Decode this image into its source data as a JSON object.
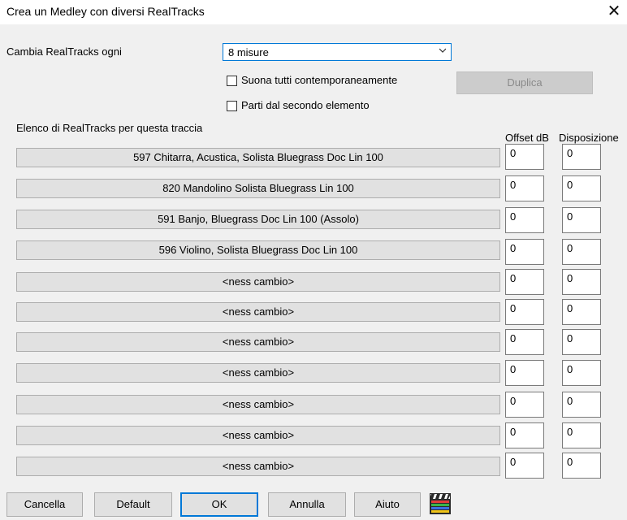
{
  "window": {
    "title": "Crea un Medley con diversi RealTracks"
  },
  "change_every": {
    "label": "Cambia RealTracks ogni",
    "selected": "8 misure"
  },
  "options": {
    "play_all_label": "Suona tutti contemporaneamente",
    "play_all_checked": false,
    "start_second_label": "Parti dal secondo elemento",
    "start_second_checked": false,
    "duplicate_label": "Duplica"
  },
  "list": {
    "heading": "Elenco di RealTracks per questa traccia",
    "col_offset": "Offset dB",
    "col_layout": "Disposizione",
    "rows": [
      {
        "label": "597 Chitarra, Acustica, Solista Bluegrass Doc Lin 100",
        "offset": "0",
        "layout": "0"
      },
      {
        "label": "820 Mandolino Solista Bluegrass Lin 100",
        "offset": "0",
        "layout": "0"
      },
      {
        "label": "591 Banjo, Bluegrass Doc Lin 100  (Assolo)",
        "offset": "0",
        "layout": "0"
      },
      {
        "label": "596 Violino, Solista Bluegrass Doc Lin 100",
        "offset": "0",
        "layout": "0"
      },
      {
        "label": "<ness cambio>",
        "offset": "0",
        "layout": "0"
      },
      {
        "label": "<ness cambio>",
        "offset": "0",
        "layout": "0"
      },
      {
        "label": "<ness cambio>",
        "offset": "0",
        "layout": "0"
      },
      {
        "label": "<ness cambio>",
        "offset": "0",
        "layout": "0"
      },
      {
        "label": "<ness cambio>",
        "offset": "0",
        "layout": "0"
      },
      {
        "label": "<ness cambio>",
        "offset": "0",
        "layout": "0"
      },
      {
        "label": "<ness cambio>",
        "offset": "0",
        "layout": "0"
      }
    ]
  },
  "buttons": {
    "cancel": "Cancella",
    "default": "Default",
    "ok": "OK",
    "annulla": "Annulla",
    "help": "Aiuto"
  },
  "icons": {
    "close": "close-icon",
    "dropdown": "chevron-down-icon",
    "video": "clapperboard-icon"
  }
}
